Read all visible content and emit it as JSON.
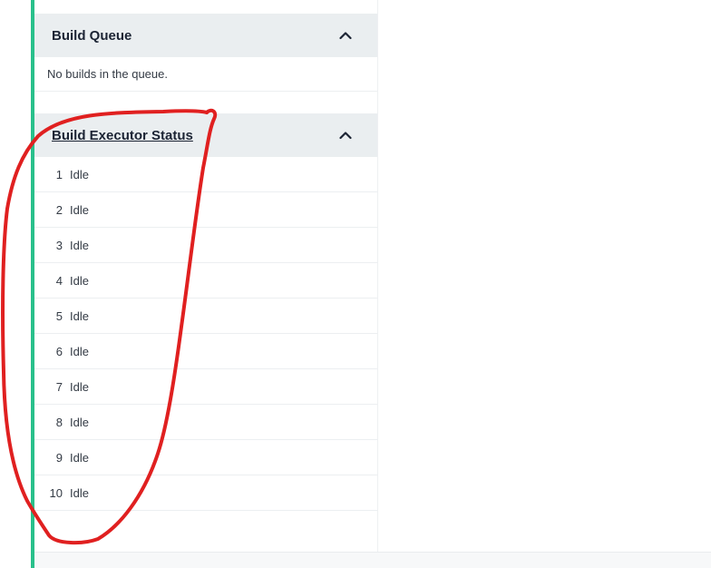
{
  "build_queue": {
    "title": "Build Queue",
    "empty_message": "No builds in the queue.",
    "collapse_icon": "chevron-up-icon"
  },
  "executor_status": {
    "title": "Build Executor Status",
    "collapse_icon": "chevron-up-icon",
    "executors": [
      {
        "number": "1",
        "status": "Idle"
      },
      {
        "number": "2",
        "status": "Idle"
      },
      {
        "number": "3",
        "status": "Idle"
      },
      {
        "number": "4",
        "status": "Idle"
      },
      {
        "number": "5",
        "status": "Idle"
      },
      {
        "number": "6",
        "status": "Idle"
      },
      {
        "number": "7",
        "status": "Idle"
      },
      {
        "number": "8",
        "status": "Idle"
      },
      {
        "number": "9",
        "status": "Idle"
      },
      {
        "number": "10",
        "status": "Idle"
      }
    ]
  },
  "colors": {
    "accent": "#29c08b",
    "header_bg": "#eaeef0",
    "annotation": "#e02020"
  }
}
